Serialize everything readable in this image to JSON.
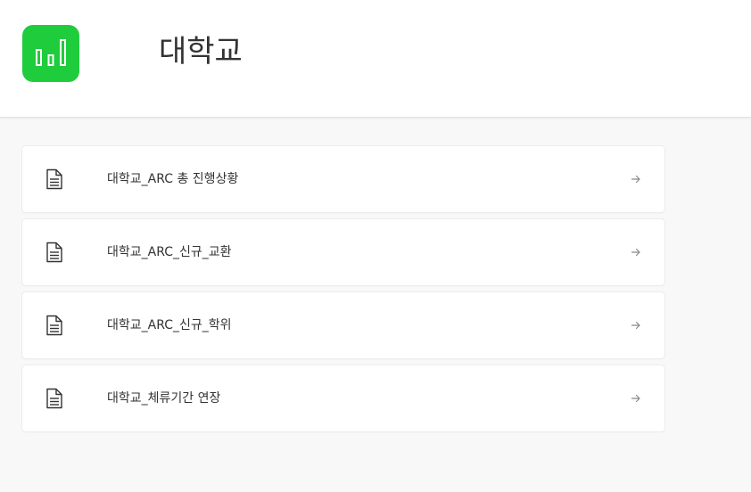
{
  "header": {
    "title": "대학교",
    "logo_icon": "bar-chart-icon",
    "logo_color": "#1fcc3c"
  },
  "items": [
    {
      "label": "대학교_ARC 총 진행상황",
      "icon": "document-icon",
      "action_icon": "arrow-right-icon"
    },
    {
      "label": "대학교_ARC_신규_교환",
      "icon": "document-icon",
      "action_icon": "arrow-right-icon"
    },
    {
      "label": "대학교_ARC_신규_학위",
      "icon": "document-icon",
      "action_icon": "arrow-right-icon"
    },
    {
      "label": "대학교_체류기간 연장",
      "icon": "document-icon",
      "action_icon": "arrow-right-icon"
    }
  ]
}
